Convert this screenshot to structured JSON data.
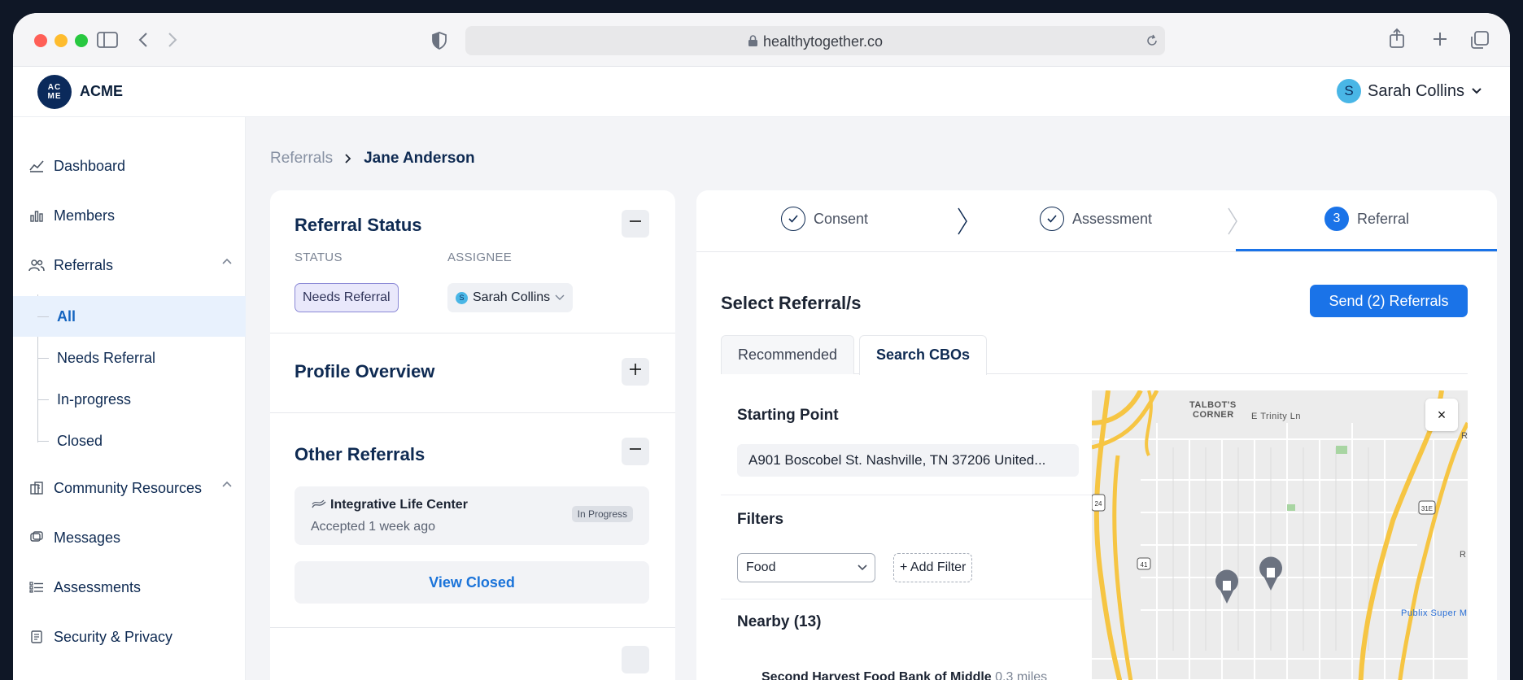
{
  "browser": {
    "url": "healthytogether.co"
  },
  "app": {
    "logo_text_line1": "AC",
    "logo_text_line2": "ME",
    "brand": "ACME",
    "user": {
      "initial": "S",
      "name": "Sarah Collins"
    }
  },
  "sidebar": {
    "items": [
      {
        "label": "Dashboard",
        "icon": "chart-line-icon"
      },
      {
        "label": "Members",
        "icon": "bar-chart-icon"
      },
      {
        "label": "Referrals",
        "icon": "users-icon"
      },
      {
        "label": "Community Resources",
        "icon": "buildings-icon"
      },
      {
        "label": "Messages",
        "icon": "chat-icon"
      },
      {
        "label": "Assessments",
        "icon": "list-icon"
      },
      {
        "label": "Security & Privacy",
        "icon": "document-icon"
      }
    ],
    "referral_subitems": [
      "All",
      "Needs Referral",
      "In-progress",
      "Closed"
    ],
    "active_subitem": "All"
  },
  "breadcrumb": {
    "parent": "Referrals",
    "current": "Jane Anderson"
  },
  "left_panel": {
    "referral_status": {
      "title": "Referral Status",
      "status_label": "STATUS",
      "status_value": "Needs Referral",
      "assignee_label": "ASSIGNEE",
      "assignee_initial": "S",
      "assignee_value": "Sarah Collins"
    },
    "profile_overview": {
      "title": "Profile Overview"
    },
    "other_referrals": {
      "title": "Other Referrals",
      "card": {
        "name": "Integrative Life Center",
        "subtitle": "Accepted 1 week ago",
        "badge": "In Progress"
      },
      "view_closed": "View Closed"
    }
  },
  "stepper": {
    "steps": [
      {
        "label": "Consent",
        "state": "done"
      },
      {
        "label": "Assessment",
        "state": "done"
      },
      {
        "label": "Referral",
        "number": "3",
        "state": "active"
      }
    ]
  },
  "right_panel": {
    "title": "Select Referral/s",
    "send_button": "Send (2) Referrals",
    "tabs": [
      "Recommended",
      "Search CBOs"
    ],
    "active_tab": "Search CBOs",
    "starting_point_label": "Starting Point",
    "starting_point_value": "A901 Boscobel St. Nashville, TN  37206 United...",
    "filters_label": "Filters",
    "filter_value": "Food",
    "add_filter": "+ Add Filter",
    "nearby_label": "Nearby (13)",
    "nearby_first_name": "Second Harvest Food Bank of Middle",
    "nearby_first_distance": " 0.3 miles",
    "map": {
      "label_talbots": "TALBOT'S",
      "label_corner": "CORNER",
      "label_trinity": "E Trinity Ln",
      "label_publix": "Publix Super M",
      "close": "×",
      "shield_24": "24",
      "shield_31e": "31E",
      "shield_41": "41",
      "label_r1": "R",
      "label_r2": "R"
    }
  },
  "colors": {
    "accent": "#1a73e8",
    "nav_text": "#0e2a52",
    "status_border": "#8a88d6"
  }
}
